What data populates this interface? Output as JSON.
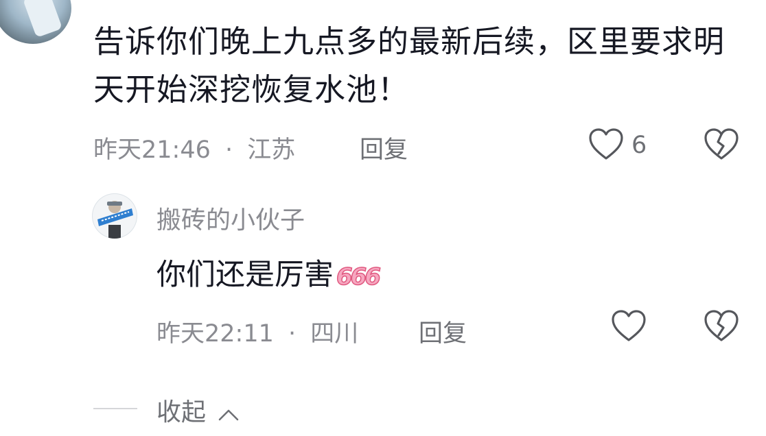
{
  "comment": {
    "text": "告诉你们晚上九点多的最新后续，区里要求明天开始深挖恢复水池！",
    "time": "昨天21:46",
    "separator": "·",
    "location": "江苏",
    "reply_label": "回复",
    "like_count": "6"
  },
  "sub_comment": {
    "username": "搬砖的小伙子",
    "text": "你们还是厉害",
    "emoji_text": "666",
    "time": "昨天22:11",
    "separator": "·",
    "location": "四川",
    "reply_label": "回复"
  },
  "collapse_label": "收起",
  "colors": {
    "primary_text": "#161823",
    "secondary_text": "#8a8b91",
    "emoji_pink": "#e0587f"
  }
}
